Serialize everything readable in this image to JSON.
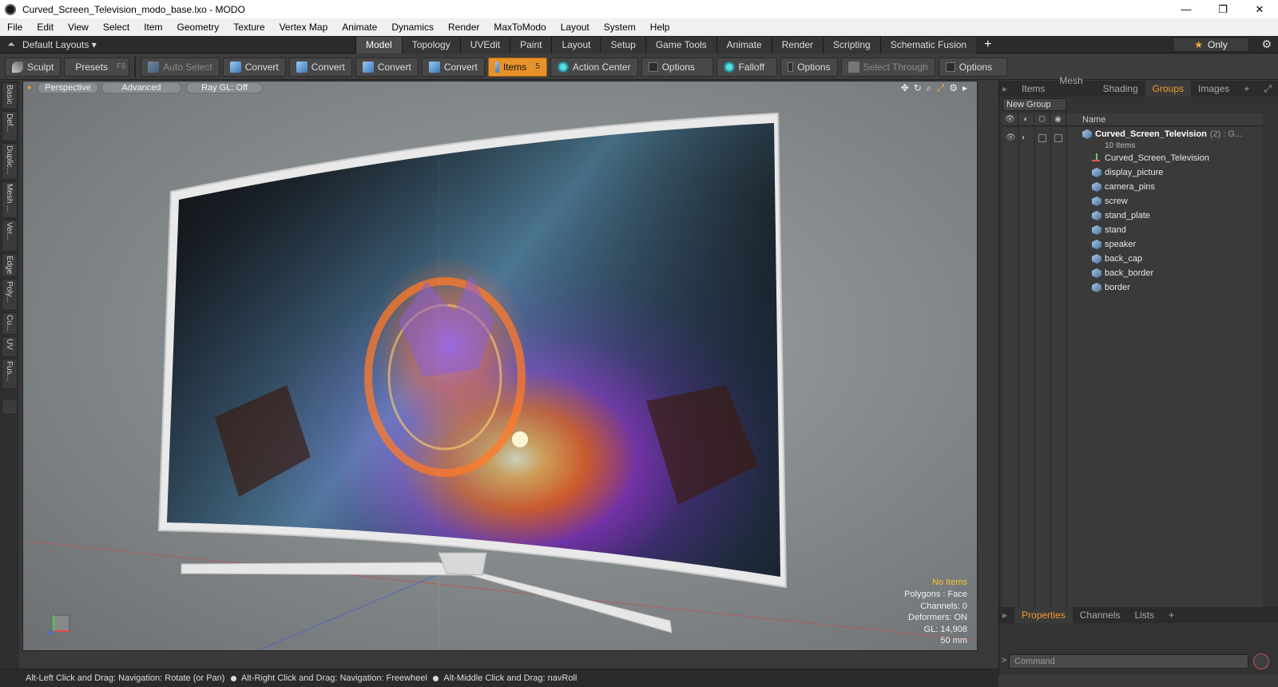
{
  "window": {
    "title": "Curved_Screen_Television_modo_base.lxo - MODO",
    "minimize": "—",
    "restore": "❐",
    "close": "✕"
  },
  "menu": [
    "File",
    "Edit",
    "View",
    "Select",
    "Item",
    "Geometry",
    "Texture",
    "Vertex Map",
    "Animate",
    "Dynamics",
    "Render",
    "MaxToModo",
    "Layout",
    "System",
    "Help"
  ],
  "layoutbar": {
    "layouts_label": "Default Layouts ▾",
    "tabs": [
      "Model",
      "Topology",
      "UVEdit",
      "Paint",
      "Layout",
      "Setup",
      "Game Tools",
      "Animate",
      "Render",
      "Scripting",
      "Schematic Fusion"
    ],
    "active_tab": "Model",
    "only_label": "Only"
  },
  "toolbar": {
    "sculpt": "Sculpt",
    "presets": "Presets",
    "presets_key": "F6",
    "auto_select": "Auto Select",
    "convert1": "Convert",
    "convert2": "Convert",
    "convert3": "Convert",
    "convert4": "Convert",
    "items": "Items",
    "items_key": "5",
    "action_center": "Action Center",
    "options1": "Options",
    "falloff": "Falloff",
    "options2": "Options",
    "select_through": "Select Through",
    "options3": "Options"
  },
  "left_tabs": [
    "Basic",
    "Def...",
    "Duplic...",
    "Mesh ...",
    "Ver...",
    "Edge",
    "Poly...",
    "Cu...",
    "UV",
    "Fus..."
  ],
  "viewport": {
    "view_mode": "Perspective",
    "shading": "Advanced",
    "raygl": "Ray GL: Off",
    "info": {
      "selection": "No Items",
      "polygons": "Polygons : Face",
      "channels": "Channels: 0",
      "deformers": "Deformers: ON",
      "gl": "GL: 14,908",
      "lens": "50 mm"
    }
  },
  "right_panel": {
    "tabs": [
      "Items",
      "Mesh ...",
      "Shading",
      "Groups",
      "Images"
    ],
    "active_tab": "Groups",
    "new_group": "New Group",
    "column_name": "Name",
    "group": {
      "name": "Curved_Screen_Television",
      "suffix": "(2) : G...",
      "count": "10 Items"
    },
    "items": [
      "Curved_Screen_Television",
      "display_picture",
      "camera_pins",
      "screw",
      "stand_plate",
      "stand",
      "speaker",
      "back_cap",
      "back_border",
      "border"
    ],
    "bottom_tabs": [
      "Properties",
      "Channels",
      "Lists"
    ],
    "bottom_active": "Properties",
    "command_placeholder": "Command"
  },
  "status": {
    "hint1": "Alt-Left Click and Drag: Navigation: Rotate (or Pan)",
    "hint2": "Alt-Right Click and Drag: Navigation: Freewheel",
    "hint3": "Alt-Middle Click and Drag: navRoll"
  },
  "colors": {
    "accent": "#e8922b",
    "active_tab_text": "#f29a2e",
    "warn": "#f6c531"
  }
}
